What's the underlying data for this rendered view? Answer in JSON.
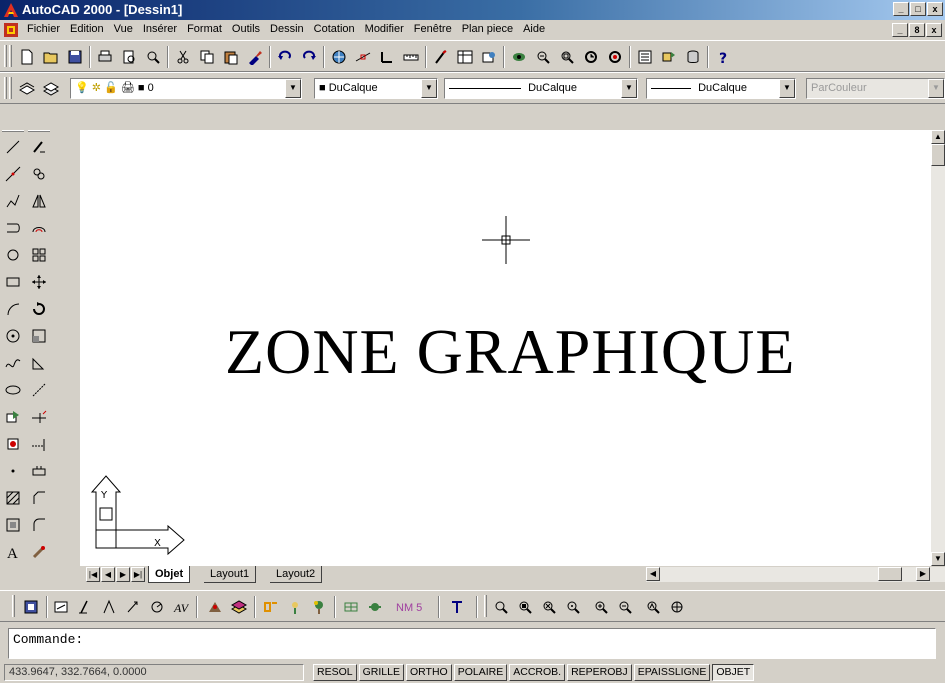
{
  "window": {
    "title": "AutoCAD 2000  - [Dessin1]",
    "controls": [
      "_",
      "□",
      "x"
    ]
  },
  "menu": [
    "Fichier",
    "Edition",
    "Vue",
    "Insérer",
    "Format",
    "Outils",
    "Dessin",
    "Cotation",
    "Modifier",
    "Fenêtre",
    "Plan piece",
    "Aide"
  ],
  "doc_controls": [
    "_",
    "8",
    "x"
  ],
  "properties": {
    "layer": "0",
    "color": "DuCalque",
    "linetype": "DuCalque",
    "lineweight": "DuCalque",
    "plotstyle": "ParCouleur"
  },
  "drawing": {
    "label": "ZONE GRAPHIQUE",
    "ucs_x": "X",
    "ucs_y": "Y"
  },
  "tabs": [
    "Objet",
    "Layout1",
    "Layout2"
  ],
  "bottom_toolbar": {
    "text_style": "NM 5"
  },
  "command": {
    "prompt": "Commande:"
  },
  "status": {
    "coords": "433.9647, 332.7664, 0.0000",
    "toggles": [
      "RESOL",
      "GRILLE",
      "ORTHO",
      "POLAIRE",
      "ACCROB.",
      "REPEROBJ",
      "EPAISSLIGNE",
      "OBJET"
    ]
  },
  "colors": {
    "title_start": "#0a246a",
    "title_end": "#a6caf0",
    "chrome": "#d4d0c8",
    "canvas": "#ffffff"
  }
}
